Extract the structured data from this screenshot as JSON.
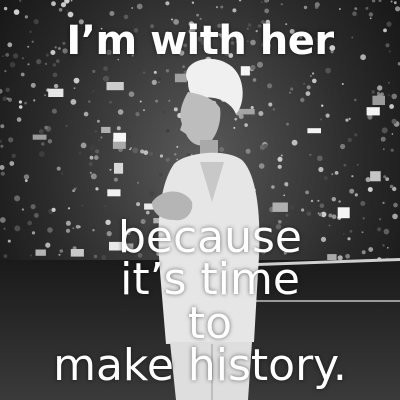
{
  "headline": "I’m with her",
  "message_lines": [
    "because",
    "it’s time",
    "to",
    "make history."
  ],
  "colors": {
    "text": "#ffffff",
    "background": "#2b2b2b",
    "figure_suit": "#e6e6e6"
  }
}
